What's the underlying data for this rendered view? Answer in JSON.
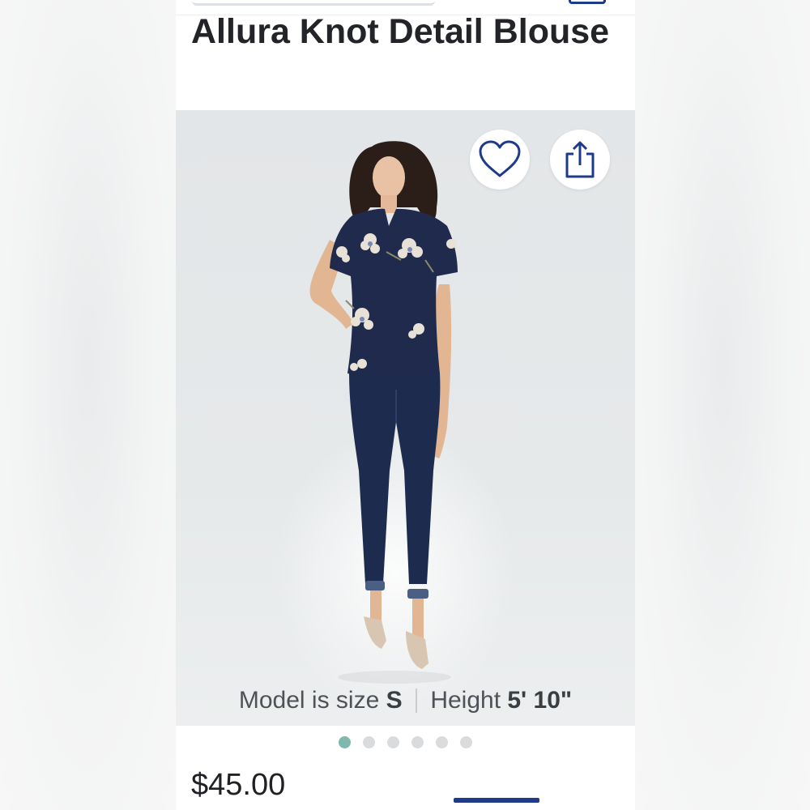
{
  "product": {
    "title": "Allura Knot Detail Blouse",
    "price": "$45.00"
  },
  "actions": {
    "favorite_icon": "heart-outline-icon",
    "share_icon": "share-upload-icon",
    "accent_color": "#1f3a8a"
  },
  "model_info": {
    "size_prefix": "Model is size",
    "size_value": "S",
    "separator": "|",
    "height_prefix": "Height",
    "height_value": "5' 10\""
  },
  "carousel": {
    "total": 6,
    "active_index": 0,
    "active_color": "#7fb8ad"
  }
}
